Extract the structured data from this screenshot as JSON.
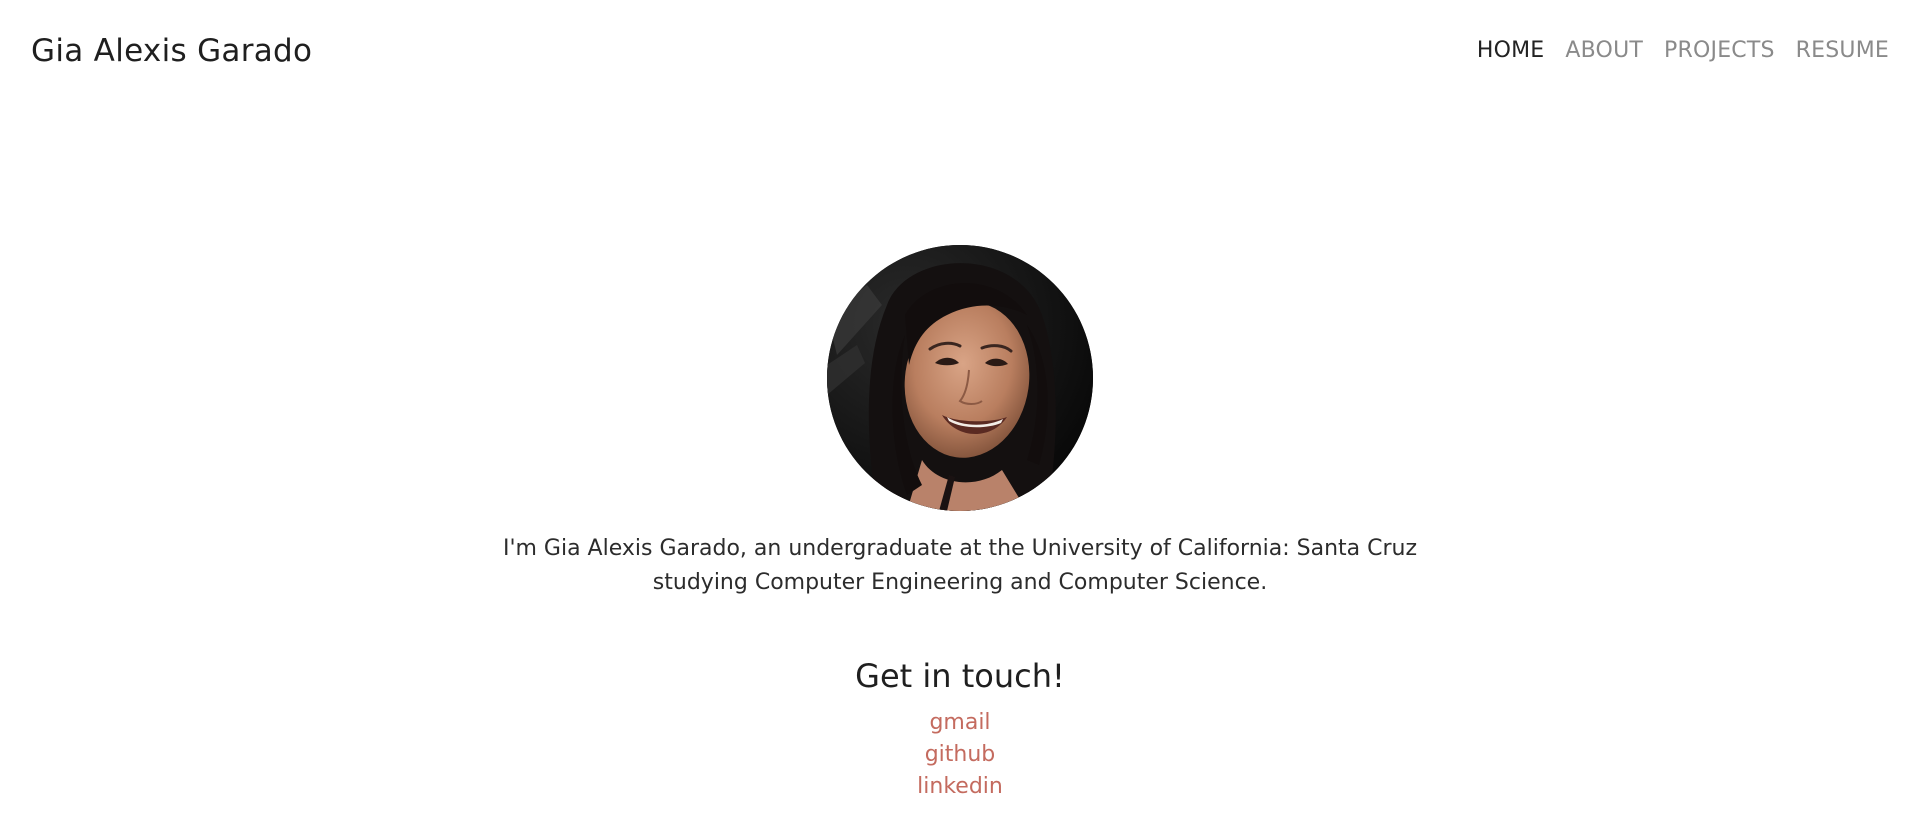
{
  "header": {
    "site_title": "Gia Alexis Garado",
    "nav": [
      {
        "label": "HOME",
        "active": true
      },
      {
        "label": "ABOUT",
        "active": false
      },
      {
        "label": "PROJECTS",
        "active": false
      },
      {
        "label": "RESUME",
        "active": false
      }
    ]
  },
  "main": {
    "bio": "I'm Gia Alexis Garado, an undergraduate at the University of California: Santa Cruz studying Computer Engineering and Computer Science.",
    "contact_heading": "Get in touch!",
    "links": [
      {
        "label": "gmail"
      },
      {
        "label": "github"
      },
      {
        "label": "linkedin"
      }
    ]
  },
  "colors": {
    "link": "#c46b5f",
    "nav_inactive": "#8a8a8a",
    "nav_active": "#222222",
    "text": "#2c2c2c"
  }
}
